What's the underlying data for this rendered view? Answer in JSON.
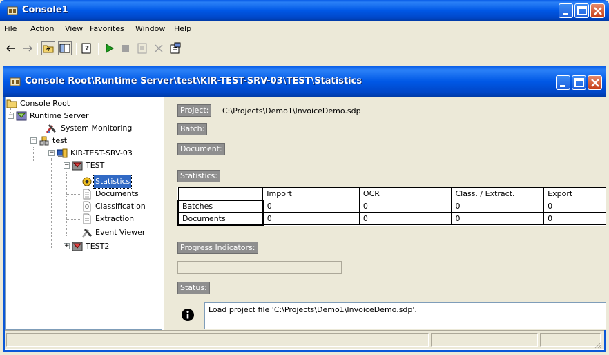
{
  "outer_window": {
    "title": "Console1"
  },
  "menu": {
    "items": [
      {
        "label": "File",
        "mnemonic": "F"
      },
      {
        "label": "Action",
        "mnemonic": "A"
      },
      {
        "label": "View",
        "mnemonic": "V"
      },
      {
        "label": "Favorites",
        "mnemonic": "o"
      },
      {
        "label": "Window",
        "mnemonic": "W"
      },
      {
        "label": "Help",
        "mnemonic": "H"
      }
    ]
  },
  "toolbar": {
    "buttons": [
      "back-arrow-icon",
      "forward-arrow-icon",
      "up-folder-icon",
      "show-hide-tree-icon",
      "help-icon",
      "play-icon",
      "stop-icon",
      "properties-icon",
      "delete-icon",
      "export-icon"
    ]
  },
  "inner_window": {
    "title": "Console Root\\Runtime Server\\test\\KIR-TEST-SRV-03\\TEST\\Statistics"
  },
  "tree": {
    "nodes": [
      {
        "label": "Console Root"
      },
      {
        "label": "Runtime Server"
      },
      {
        "label": "System Monitoring"
      },
      {
        "label": "test"
      },
      {
        "label": "KIR-TEST-SRV-03"
      },
      {
        "label": "TEST"
      },
      {
        "label": "Statistics",
        "selected": true
      },
      {
        "label": "Documents"
      },
      {
        "label": "Classification"
      },
      {
        "label": "Extraction"
      },
      {
        "label": "Event Viewer"
      },
      {
        "label": "TEST2"
      }
    ]
  },
  "panel": {
    "project_label": "Project:",
    "project_value": "C:\\Projects\\Demo1\\InvoiceDemo.sdp",
    "batch_label": "Batch:",
    "document_label": "Document:",
    "statistics_label": "Statistics:",
    "table": {
      "columns": [
        "",
        "Import",
        "OCR",
        "Class. / Extract.",
        "Export"
      ],
      "rows": [
        {
          "name": "Batches",
          "values": [
            "0",
            "0",
            "0",
            "0"
          ]
        },
        {
          "name": "Documents",
          "values": [
            "0",
            "0",
            "0",
            "0"
          ]
        }
      ]
    },
    "progress_label": "Progress Indicators:",
    "progress_value": 0,
    "status_label": "Status:",
    "status_message": "Load project file 'C:\\Projects\\Demo1\\InvoiceDemo.sdp'."
  },
  "colors": {
    "titlebar": "#0058e6",
    "selection": "#316ac5",
    "panel_bg": "#ece9d8"
  }
}
